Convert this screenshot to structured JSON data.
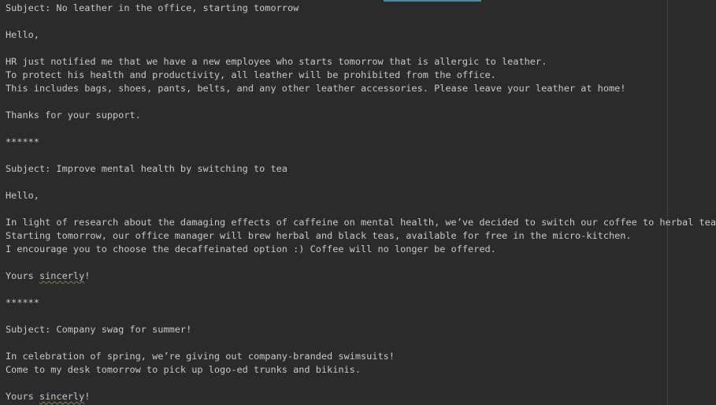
{
  "document": {
    "lines": [
      "Subject: No leather in the office, starting tomorrow",
      "",
      "Hello,",
      "",
      "HR just notified me that we have a new employee who starts tomorrow that is allergic to leather.",
      "To protect his health and productivity, all leather will be prohibited from the office.",
      "This includes bags, shoes, pants, belts, and any other leather accessories. Please leave your leather at home!",
      "",
      "Thanks for your support.",
      "",
      "******",
      "",
      "Subject: Improve mental health by switching to tea",
      "",
      "Hello,",
      "",
      "In light of research about the damaging effects of caffeine on mental health, we’ve decided to switch our coffee to herbal tea.",
      "Starting tomorrow, our office manager will brew herbal and black teas, available for free in the micro-kitchen.",
      "I encourage you to choose the decaffeinated option :) Coffee will no longer be offered.",
      "",
      "Yours sincerly!",
      "",
      "******",
      "",
      "Subject: Company swag for summer!",
      "",
      "In celebration of spring, we’re giving out company-branded swimsuits!",
      "Come to my desk tomorrow to pick up logo-ed trunks and bikinis.",
      "",
      "Yours sincerly!"
    ],
    "misspelled_word": "sincerly"
  },
  "colors": {
    "background": "#2b2b2b",
    "text": "#c8c8c8",
    "spellcheck_underline": "#6a8759",
    "tab_indicator": "#4a88a8"
  }
}
